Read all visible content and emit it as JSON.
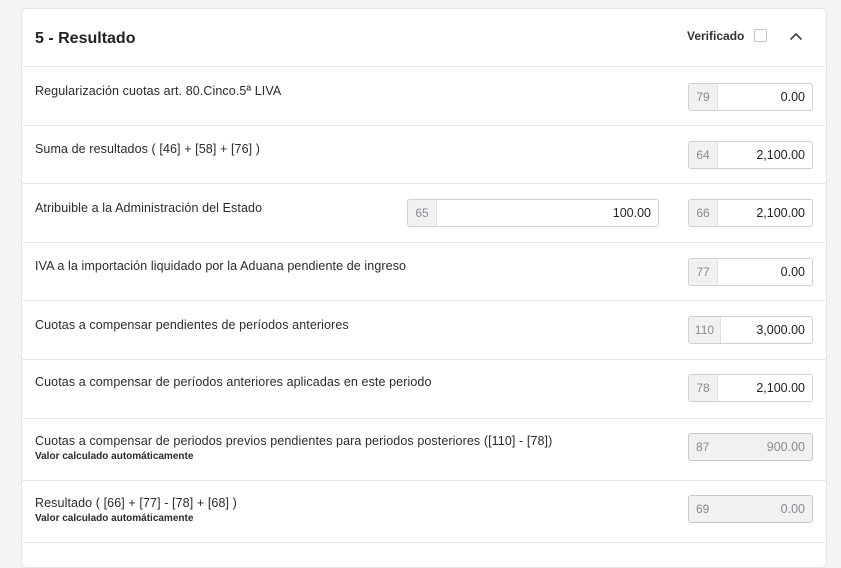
{
  "section": {
    "title": "5 - Resultado",
    "verified_label": "Verificado",
    "verified_checked": false,
    "collapse_icon": "chevron-up-icon"
  },
  "rows": [
    {
      "label": "Regularización cuotas art. 80.Cinco.5ª LIVA",
      "box": "79",
      "value": "0.00"
    },
    {
      "label": "Suma de resultados ( [46] + [58] + [76] )",
      "box": "64",
      "value": "2,100.00"
    },
    {
      "label": "Atribuible a la Administración del Estado",
      "box_a": "65",
      "value_a": "100.00",
      "box": "66",
      "value": "2,100.00"
    },
    {
      "label": "IVA a la importación liquidado por la Aduana pendiente de ingreso",
      "box": "77",
      "value": "0.00"
    },
    {
      "label": "Cuotas a compensar pendientes de períodos anteriores",
      "box": "110",
      "value": "3,000.00"
    },
    {
      "label": "Cuotas a compensar de períodos anteriores aplicadas en este periodo",
      "box": "78",
      "value": "2,100.00"
    },
    {
      "label": "Cuotas a compensar de periodos previos pendientes para periodos posteriores ([110] - [78])",
      "sublabel": "Valor calculado automáticamente",
      "box": "87",
      "value": "900.00"
    },
    {
      "label": "Resultado ( [66] + [77] - [78] + [68] )",
      "sublabel": "Valor calculado automáticamente",
      "box": "69",
      "value": "0.00"
    }
  ]
}
